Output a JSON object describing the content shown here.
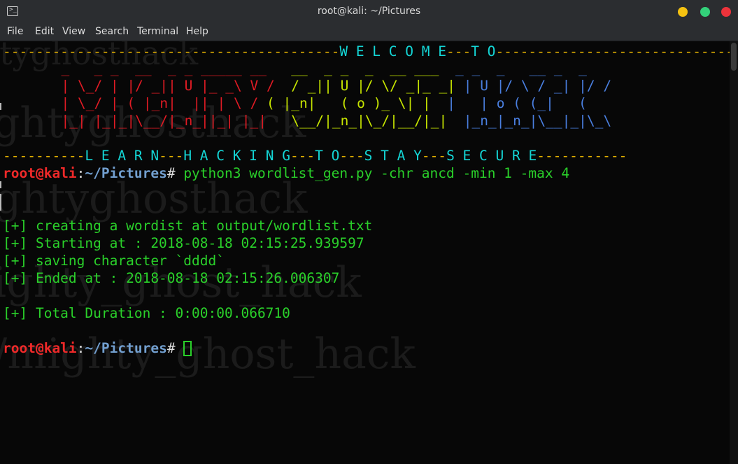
{
  "window": {
    "title": "root@kali: ~/Pictures",
    "controls": {
      "minimize_color": "#f5c211",
      "maximize_color": "#33d17a",
      "close_color": "#ed333b"
    }
  },
  "menu": [
    "File",
    "Edit",
    "View",
    "Search",
    "Terminal",
    "Help"
  ],
  "watermark": [
    "ghtyghosthack",
    "ghtyghosthack",
    "ighty_ghost_hack",
    "/mighty_ghost_hack"
  ],
  "banner": {
    "welcome_left": "-----------------------------------------",
    "welcome_text": "W E L C O M E",
    "welcome_mid": "---",
    "welcome_to": "T O",
    "welcome_right": "-----------------------------------",
    "art_row0_a": "  _   _ _  __  _ _ _____ __",
    "art_row0_b": "   __  _ _  _  __ ___",
    "art_row0_c": "  _ _  _   __ _  _",
    "art_row1_a": "  | \\_/ | |/ _|| U |_ _\\ V /",
    "art_row1_b": "  / _|| U |/ \\/ _|_ _|",
    "art_row1_c": " | U |/ \\ / _| |/ /",
    "art_row2_a": "  | \\_/ | ( |_n|  || | \\ /",
    "art_row2_b": " ( |_n|   ( o )_ \\| |",
    "art_row2_c": "  |   | o ( (_|   (",
    "art_row3_a": "  |_| |_|_|\\__/|_n_||_| |_|",
    "art_row3_b": "   \\__/|_n_|\\_/|__/|_|",
    "art_row3_c": "  |_n_|_n_|\\__|_|\\_\\",
    "learn_left": "----------",
    "learn": "L E A R N",
    "d1": "---",
    "hacking": "H A C K I N G",
    "d2": "---",
    "to": "T O",
    "d3": "---",
    "stay": "S T A Y",
    "d4": "---",
    "secure": "S E C U R E",
    "learn_right": "-----------"
  },
  "prompt": {
    "user_host": "root@kali",
    "colon": ":",
    "path": "~/Pictures",
    "symbol": "#"
  },
  "command": " python3 wordlist_gen.py -chr ancd -min 1 -max 4",
  "output": [
    "[+] creating a wordist at output/wordlist.txt",
    "[+] Starting at : 2018-08-18 02:15:25.939597",
    "[+] saving character `dddd`",
    "[+] Ended at : 2018-08-18 02:15:26.006307",
    "[+] Total Duration : 0:00:00.066710"
  ]
}
